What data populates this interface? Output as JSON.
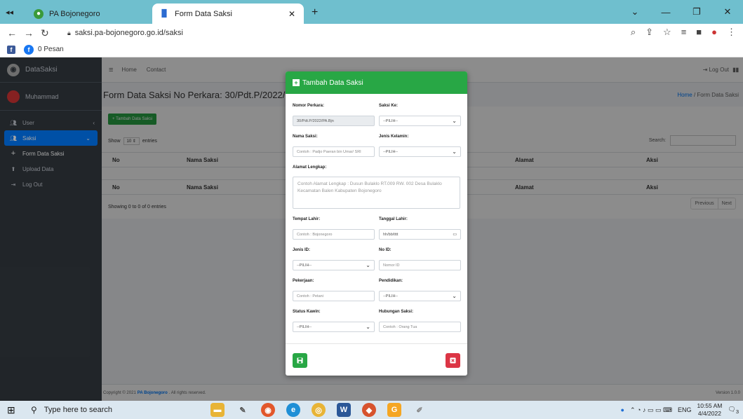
{
  "browser": {
    "tabs": [
      {
        "title": "PA Bojonegoro"
      },
      {
        "title": "Form Data Saksi"
      }
    ],
    "url": "saksi.pa-bojonegoro.go.id/saksi",
    "bookmark_label": "0 Pesan"
  },
  "sidebar": {
    "brand": "DataSaksi",
    "user_name": "Muhammad",
    "items": [
      {
        "label": "User",
        "icon": "users-icon"
      },
      {
        "label": "Saksi",
        "icon": "users-icon"
      },
      {
        "label": "Form Data Saksi",
        "icon": "plus-icon"
      },
      {
        "label": "Upload Data",
        "icon": "upload-icon"
      },
      {
        "label": "Log Out",
        "icon": "logout-icon"
      }
    ]
  },
  "topbar": {
    "home": "Home",
    "contact": "Contact",
    "logout": "Log Out"
  },
  "page": {
    "title": "Form Data Saksi No Perkara: 30/Pdt.P/2022/PA.Bjn",
    "breadcrumb_home": "Home",
    "breadcrumb_current": "Form Data Saksi"
  },
  "table": {
    "add_button": "+ Tambah Data Saksi",
    "show_label": "Show",
    "show_value": "10",
    "entries_label": "entries",
    "search_label": "Search:",
    "columns": [
      "No",
      "Nama Saksi",
      "Alamat",
      "Aksi"
    ],
    "showing_text": "Showing 0 to 0 of 0 entries",
    "previous": "Previous",
    "next": "Next"
  },
  "modal": {
    "title": "Tambah Data Saksi",
    "fields": {
      "nomor_perkara_label": "Nomor Perkara:",
      "nomor_perkara_value": "30/Pdt.P/2022/PA.Bjn",
      "saksi_ke_label": "Saksi Ke:",
      "saksi_ke_value": "--PILIH--",
      "nama_saksi_label": "Nama Saksi:",
      "nama_saksi_placeholder": "Contoh : Padjo Paeran bin Umar/ SRI",
      "jenis_kelamin_label": "Jenis Kelamin:",
      "jenis_kelamin_value": "--PILIH--",
      "alamat_label": "Alamat Lengkap:",
      "alamat_placeholder": "Contoh Alamat Lengkap : Dusun Bulaklo RT.009 RW. 002 Desa Bulaklo Kecamatan Balen Kabupaten Bojonegoro",
      "tempat_lahir_label": "Tempat Lahir:",
      "tempat_lahir_placeholder": "Contoh : Bojonegoro",
      "tanggal_lahir_label": "Tanggal Lahir:",
      "tanggal_lahir_placeholder": "hh/bb/tttt",
      "jenis_id_label": "Jenis ID:",
      "jenis_id_value": "--PILIH--",
      "no_id_label": "No ID:",
      "no_id_placeholder": "Nomor ID",
      "pekerjaan_label": "Pekerjaan:",
      "pekerjaan_placeholder": "Contoh : Petani",
      "pendidikan_label": "Pendidikan:",
      "pendidikan_value": "--PILIH--",
      "status_kawin_label": "Status Kawin:",
      "status_kawin_value": "--PILIH--",
      "hubungan_label": "Hubungan Saksi:",
      "hubungan_placeholder": "Contoh : Orang Tua"
    }
  },
  "footer": {
    "copyright_prefix": "Copyright © 2021",
    "copyright_link": "PA Bojonegoro",
    "copyright_suffix": ". All rights reserved.",
    "version": "Version 1.0.0"
  },
  "taskbar": {
    "search_placeholder": "Type here to search",
    "language": "ENG",
    "time": "10:55 AM",
    "date": "4/4/2022",
    "notification_count": "3"
  },
  "colors": {
    "chrome_bar": "#6fbfce",
    "sidebar": "#343a40",
    "primary": "#007bff",
    "success": "#28a745",
    "danger": "#dc3545"
  }
}
